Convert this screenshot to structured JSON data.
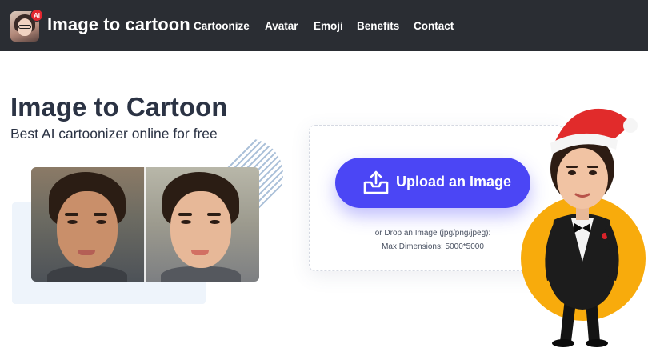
{
  "header": {
    "brand": "Image to cartoon",
    "logo_badge": "AI",
    "nav": [
      {
        "label": "Cartoonize"
      },
      {
        "label": "Avatar"
      },
      {
        "label": "Emoji"
      },
      {
        "label": "Benefits"
      },
      {
        "label": "Contact"
      }
    ]
  },
  "hero": {
    "title": "Image to Cartoon",
    "subtitle": "Best AI cartoonizer online for free"
  },
  "upload": {
    "button_label": "Upload an Image",
    "icon": "upload-tray-icon",
    "hint_line1": "or Drop an Image (jpg/png/jpeg):",
    "hint_line2": "Max Dimensions: 5000*5000"
  },
  "colors": {
    "navbar": "#2a2d33",
    "accent": "#4b46f5",
    "title_text": "#2b3344",
    "mascot_circle": "#f8ab0c",
    "santa_hat": "#e12b2b"
  }
}
